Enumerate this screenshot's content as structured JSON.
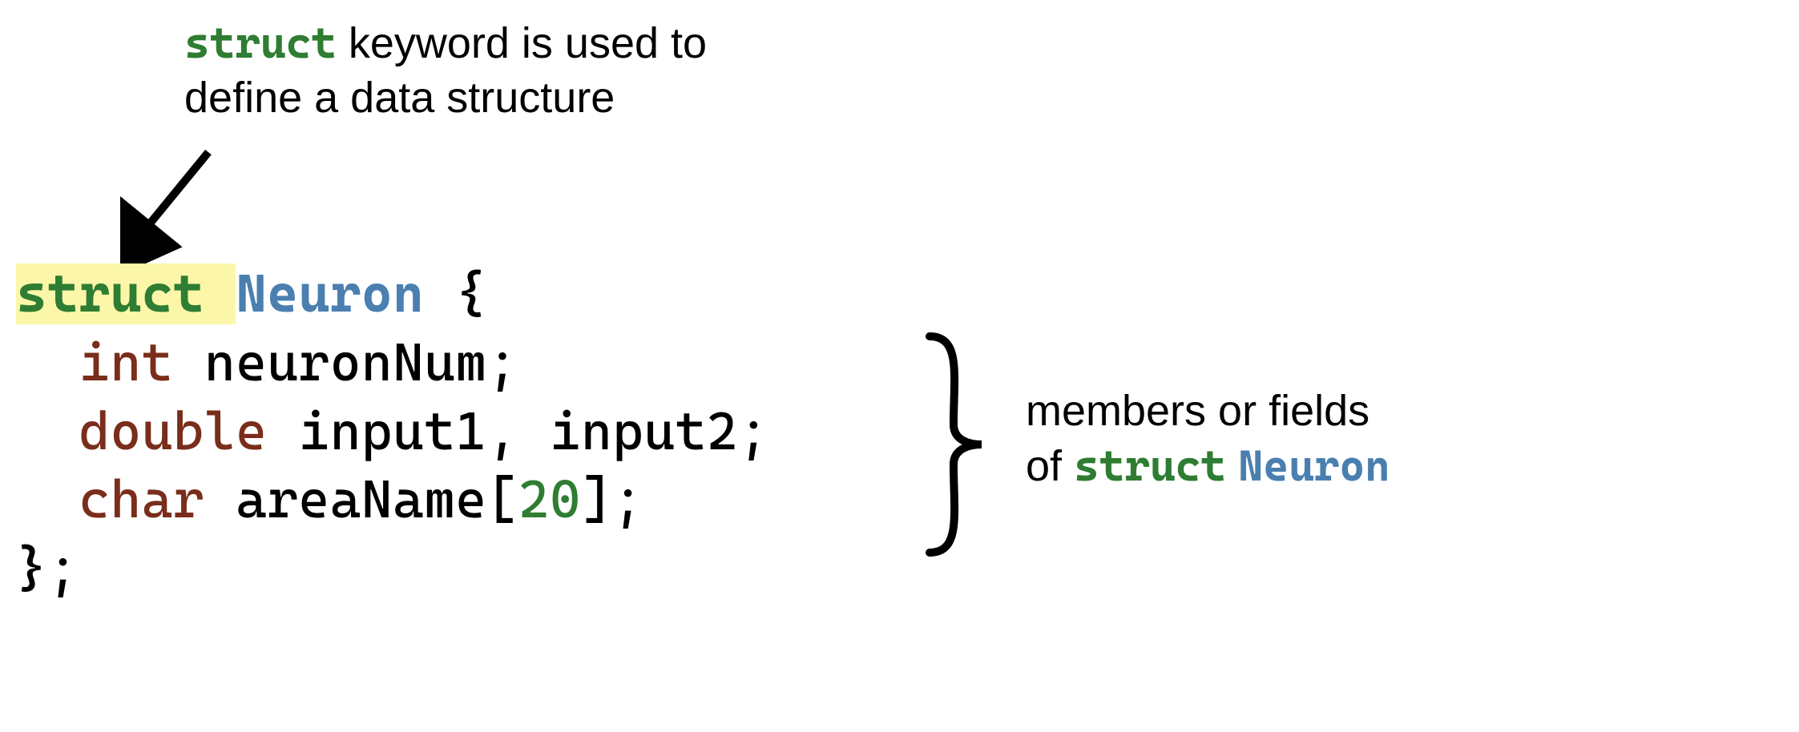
{
  "topExplain": {
    "kw": "struct",
    "line1_rest": " keyword is used to",
    "line2": "define a data structure"
  },
  "code": {
    "struct_kw": "struct",
    "type_name": "Neuron",
    "open": " {",
    "line2_type": "int",
    "line2_rest": " neuronNum;",
    "line3_type": "double",
    "line3_rest": " input1, input2;",
    "line4_type": "char",
    "line4_mid": " areaName[",
    "line4_num": "20",
    "line4_end": "];",
    "close": "};"
  },
  "rightExplain": {
    "line1": "members or fields",
    "line2_pre": "of ",
    "line2_kw": "struct",
    "line2_type": "Neuron"
  }
}
